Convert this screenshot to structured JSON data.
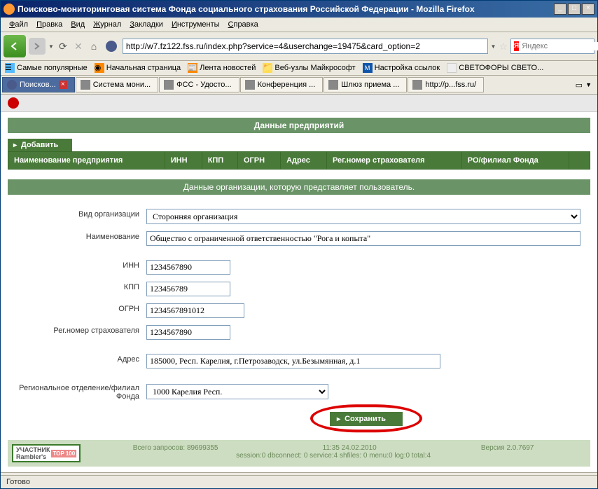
{
  "window": {
    "title": "Поисково-мониторинговая система Фонда социального страхования Российской Федерации - Mozilla Firefox"
  },
  "menu": {
    "items": [
      "Файл",
      "Правка",
      "Вид",
      "Журнал",
      "Закладки",
      "Инструменты",
      "Справка"
    ]
  },
  "nav": {
    "url": "http://w7.fz122.fss.ru/index.php?service=4&userchange=19475&card_option=2",
    "search_placeholder": "Яндекс"
  },
  "bookmarks": [
    {
      "label": "Самые популярные"
    },
    {
      "label": "Начальная страница"
    },
    {
      "label": "Лента новостей"
    },
    {
      "label": "Веб-узлы Майкрософт"
    },
    {
      "label": "Настройка ссылок"
    },
    {
      "label": "СВЕТОФОРЫ СВЕТО..."
    }
  ],
  "tabs": [
    {
      "label": "Поисков..."
    },
    {
      "label": "Система мони..."
    },
    {
      "label": "ФСС - Удосто..."
    },
    {
      "label": "Конференция ..."
    },
    {
      "label": "Шлюз приема ..."
    },
    {
      "label": "http://p...fss.ru/"
    }
  ],
  "sections": {
    "enterprises": "Данные предприятий",
    "add_btn": "Добавить",
    "columns": [
      "Наименование предприятия",
      "ИНН",
      "КПП",
      "ОГРН",
      "Адрес",
      "Рег.номер страхователя",
      "РО/филиал Фонда",
      ""
    ],
    "org_header": "Данные организации, которую представляет пользователь."
  },
  "form": {
    "labels": {
      "org_type": "Вид организации",
      "name": "Наименование",
      "inn": "ИНН",
      "kpp": "КПП",
      "ogrn": "ОГРН",
      "reg": "Рег.номер страхователя",
      "addr": "Адрес",
      "regional": "Региональное отделение/филиал Фонда"
    },
    "values": {
      "org_type": "Сторонняя организация",
      "name": "Общество с ограниченной ответственностью \"Рога и копыта\"",
      "inn": "1234567890",
      "kpp": "123456789",
      "ogrn": "1234567891012",
      "reg": "1234567890",
      "addr": "185000, Респ. Карелия, г.Петрозаводск, ул.Безымянная, д.1",
      "regional": "1000 Карелия Респ."
    },
    "save_btn": "Сохранить"
  },
  "footer": {
    "rambler": "УЧАСТНИК",
    "rambler2": "Rambler's",
    "top100": "TOP 100",
    "requests": "Всего запросов: 89699355",
    "datetime": "11:35 24.02.2010",
    "version": "Версия 2.0.7697",
    "session": "session:0 dbconnect: 0 service:4 shfiles: 0 menu:0 log:0 total:4"
  },
  "status": "Готово"
}
